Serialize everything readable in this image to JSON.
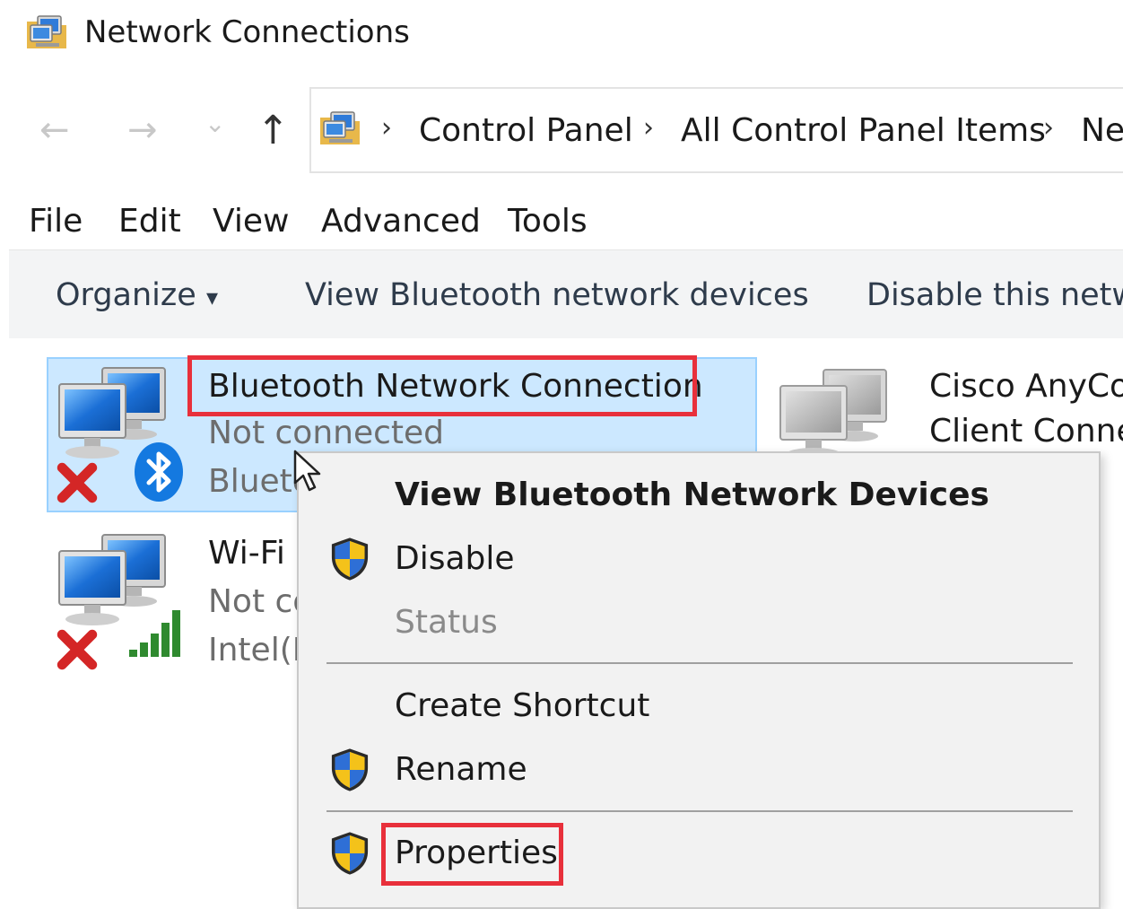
{
  "window": {
    "title": "Network Connections"
  },
  "nav": {
    "back_glyph": "←",
    "forward_glyph": "→",
    "recent_glyph": "⌄",
    "up_glyph": "↑"
  },
  "address": {
    "crumbs": [
      "Control Panel",
      "All Control Panel Items",
      "Ne"
    ],
    "separator": "›"
  },
  "menubar": [
    "File",
    "Edit",
    "View",
    "Advanced",
    "Tools"
  ],
  "toolbar": {
    "organize": "Organize",
    "organize_caret": "▾",
    "view_devices": "View Bluetooth network devices",
    "disable": "Disable this netw"
  },
  "connections": [
    {
      "name": "Bluetooth Network Connection",
      "status": "Not connected",
      "device": "Blueto",
      "icon": "bluetooth-network-icon",
      "selected": true
    },
    {
      "name": "Wi-Fi",
      "status": "Not co",
      "device": "Intel(F",
      "icon": "wifi-network-icon",
      "selected": false
    },
    {
      "name": "Cisco AnyCo",
      "name_line2": "Client Conne",
      "icon": "cisco-network-icon",
      "selected": false
    }
  ],
  "context_menu": {
    "items": [
      {
        "label": "View Bluetooth Network Devices",
        "bold": true,
        "shield": false,
        "disabled": false
      },
      {
        "label": "Disable",
        "bold": false,
        "shield": true,
        "disabled": false
      },
      {
        "label": "Status",
        "bold": false,
        "shield": false,
        "disabled": true
      },
      {
        "label": "Create Shortcut",
        "bold": false,
        "shield": false,
        "disabled": false
      },
      {
        "label": "Rename",
        "bold": false,
        "shield": true,
        "disabled": false
      },
      {
        "label": "Properties",
        "bold": false,
        "shield": true,
        "disabled": false
      }
    ]
  },
  "colors": {
    "selection_bg": "#cce8ff",
    "highlight_box": "#e8303b",
    "status_x": "#d42626",
    "bluetooth_blue": "#1479e0",
    "signal_green": "#2f8a2f"
  }
}
